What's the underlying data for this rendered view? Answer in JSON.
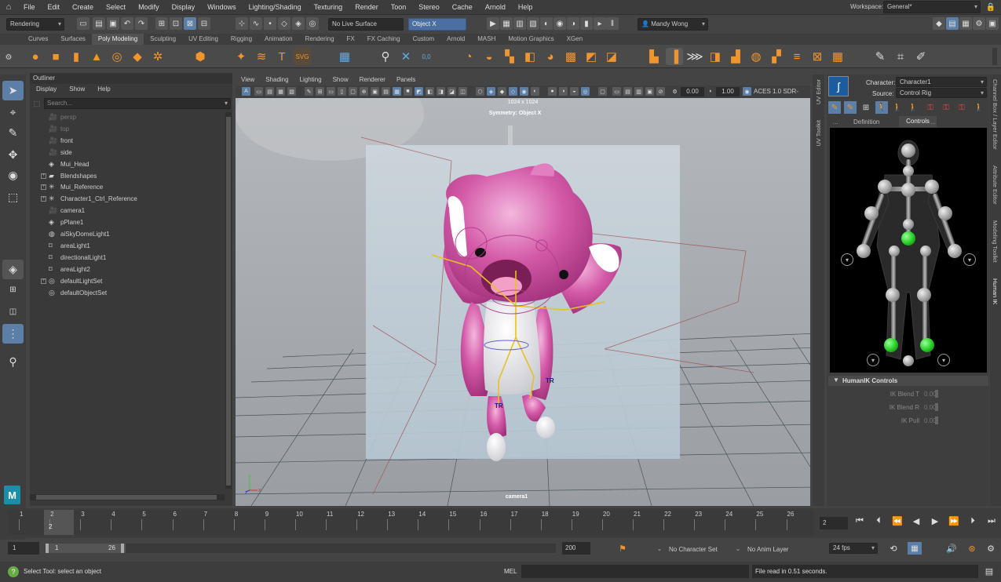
{
  "menubar": {
    "items": [
      "File",
      "Edit",
      "Create",
      "Select",
      "Modify",
      "Display",
      "Windows",
      "Lighting/Shading",
      "Texturing",
      "Render",
      "Toon",
      "Stereo",
      "Cache",
      "Arnold",
      "Help"
    ],
    "workspace_label": "Workspace:",
    "workspace_value": "General*"
  },
  "statusline": {
    "menuset": "Rendering",
    "live_surface": "No Live Surface",
    "object_mode": "Object X",
    "user": "Mandy Wong"
  },
  "shelf_tabs": [
    "Curves",
    "Surfaces",
    "Poly Modeling",
    "Sculpting",
    "UV Editing",
    "Rigging",
    "Animation",
    "Rendering",
    "FX",
    "FX Caching",
    "Custom",
    "Arnold",
    "MASH",
    "Motion Graphics",
    "XGen"
  ],
  "active_shelf_tab": "Poly Modeling",
  "outliner": {
    "title": "Outliner",
    "menu": [
      "Display",
      "Show",
      "Help"
    ],
    "search_placeholder": "Search...",
    "items": [
      {
        "label": "persp",
        "icon": "camera-icon",
        "dim": true,
        "expand": false
      },
      {
        "label": "top",
        "icon": "camera-icon",
        "dim": true,
        "expand": false
      },
      {
        "label": "front",
        "icon": "camera-icon",
        "dim": false,
        "expand": false
      },
      {
        "label": "side",
        "icon": "camera-icon",
        "dim": false,
        "expand": false
      },
      {
        "label": "Mui_Head",
        "icon": "mesh-icon",
        "dim": false,
        "expand": false
      },
      {
        "label": "Blendshapes",
        "icon": "blendshape-icon",
        "dim": false,
        "expand": true
      },
      {
        "label": "Mui_Reference",
        "icon": "joint-icon",
        "dim": false,
        "expand": true
      },
      {
        "label": "Character1_Ctrl_Reference",
        "icon": "joint-icon",
        "dim": false,
        "expand": true
      },
      {
        "label": "camera1",
        "icon": "camera-icon",
        "dim": false,
        "expand": false
      },
      {
        "label": "pPlane1",
        "icon": "mesh-icon",
        "dim": false,
        "expand": false
      },
      {
        "label": "aiSkyDomeLight1",
        "icon": "skydome-icon",
        "dim": false,
        "expand": false
      },
      {
        "label": "areaLight1",
        "icon": "area-light-icon",
        "dim": false,
        "expand": false
      },
      {
        "label": "directionalLight1",
        "icon": "directional-light-icon",
        "dim": false,
        "expand": false
      },
      {
        "label": "areaLight2",
        "icon": "area-light-icon",
        "dim": false,
        "expand": false
      },
      {
        "label": "defaultLightSet",
        "icon": "set-icon",
        "dim": false,
        "expand": true
      },
      {
        "label": "defaultObjectSet",
        "icon": "set-icon",
        "dim": false,
        "expand": false
      }
    ]
  },
  "viewport": {
    "menu": [
      "View",
      "Shading",
      "Lighting",
      "Show",
      "Renderer",
      "Panels"
    ],
    "resolution_label": "1024 x 1024",
    "symmetry_label": "Symmetry: Object X",
    "camera_label": "camera1",
    "near_value": "0.00",
    "far_value": "1.00",
    "color_space": "ACES 1.0 SDR-video",
    "rig_label_a": "TR",
    "rig_label_b": "TR",
    "axis_y": "y",
    "axis_z": "z",
    "axis_x": "x"
  },
  "side_tabs": {
    "left_a": "UV Editor",
    "left_b": "UV Toolkit",
    "right_a": "Channel Box / Layer Editor",
    "right_b": "Attribute Editor",
    "right_c": "Modeling Toolkit",
    "right_d": "Human IK"
  },
  "humanik": {
    "character_label": "Character:",
    "character_value": "Character1",
    "source_label": "Source:",
    "source_value": "Control Rig",
    "tabs": [
      "...",
      "Definition",
      "Controls",
      "..."
    ],
    "active_tab": "Controls",
    "controls_header": "HumanIK Controls",
    "ik_blend_t_label": "IK Blend T",
    "ik_blend_t_value": "0.00",
    "ik_blend_r_label": "IK Blend R",
    "ik_blend_r_value": "0.00",
    "ik_pull_label": "IK Pull",
    "ik_pull_value": "0.00"
  },
  "timeline": {
    "ticks": [
      "1",
      "2",
      "3",
      "4",
      "5",
      "6",
      "7",
      "8",
      "9",
      "10",
      "11",
      "12",
      "13",
      "14",
      "15",
      "16",
      "17",
      "18",
      "19",
      "20",
      "21",
      "22",
      "23",
      "24",
      "25",
      "26"
    ],
    "current_frame": "2",
    "current_frame_field": "2"
  },
  "range": {
    "start": "1",
    "inner_start": "1",
    "inner_end": "26",
    "end": "200",
    "character_set": "No Character Set",
    "anim_layer": "No Anim Layer",
    "fps": "24 fps"
  },
  "commandline": {
    "help_text": "Select Tool: select an object",
    "lang": "MEL",
    "result": "File read in  0.51 seconds."
  },
  "colors": {
    "accent": "#5b7fa6",
    "character_pink": "#d45aa8",
    "hik_active_joint": "#22cc22",
    "rig_yellow": "#e8c020"
  }
}
